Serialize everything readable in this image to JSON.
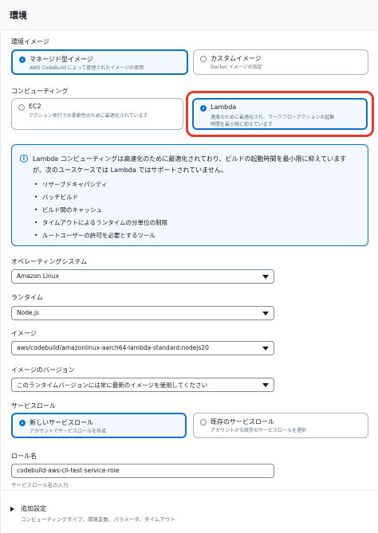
{
  "header": {
    "title": "環境"
  },
  "image": {
    "label": "環境イメージ",
    "options": [
      {
        "title": "マネージド型イメージ",
        "desc": "AWS CodeBuild によって管理されたイメージの使用",
        "selected": true
      },
      {
        "title": "カスタムイメージ",
        "desc": "Docker イメージの指定",
        "selected": false
      }
    ]
  },
  "compute": {
    "label": "コンピューティング",
    "options": [
      {
        "title": "EC2",
        "desc": "アクション実行での柔軟性のために最適化されています",
        "selected": false
      },
      {
        "title": "Lambda",
        "desc1": "速度のために最適化され、ワークフローアクションの起動",
        "desc2": "時間を最小限に抑えています",
        "selected": true
      }
    ]
  },
  "info": {
    "text1": "Lambda コンピューティングは高速化のために最適化されており、ビルドの起動時間を最小限に抑えています",
    "text2": "が、次のユースケースでは Lambda ではサポートされていません。",
    "items": [
      "リザーブドキャパシティ",
      "バッチビルド",
      "ビルド間のキャッシュ",
      "タイムアウトによるランタイムの分単位の制限",
      "ルートユーザーの許可を必要とするツール"
    ]
  },
  "os": {
    "label": "オペレーティングシステム",
    "value": "Amazon Linux"
  },
  "runtime": {
    "label": "ランタイム",
    "value": "Node.js"
  },
  "imageSel": {
    "label": "イメージ",
    "value": "aws/codebuild/amazonlinux-aarch64-lambda-standard:nodejs20"
  },
  "imageVersion": {
    "label": "イメージのバージョン",
    "value": "このランタイムバージョンには常に最新のイメージを使用してください"
  },
  "serviceRole": {
    "label": "サービスロール",
    "options": [
      {
        "title": "新しいサービスロール",
        "desc": "アカウントでサービスロールを作成",
        "selected": true
      },
      {
        "title": "既存のサービスロール",
        "desc": "アカウントから既存のサービスロールを選択",
        "selected": false
      }
    ]
  },
  "roleName": {
    "label": "ロール名",
    "value": "codebuild-aws-cli-test-service-role",
    "hint": "サービスロール名の入力"
  },
  "additional": {
    "title": "追加設定",
    "desc": "コンピューティングタイプ、環境変数、パラメータ、タイムアウト"
  },
  "colors": {
    "accent": "#0972d3",
    "highlight": "#e8392a"
  }
}
